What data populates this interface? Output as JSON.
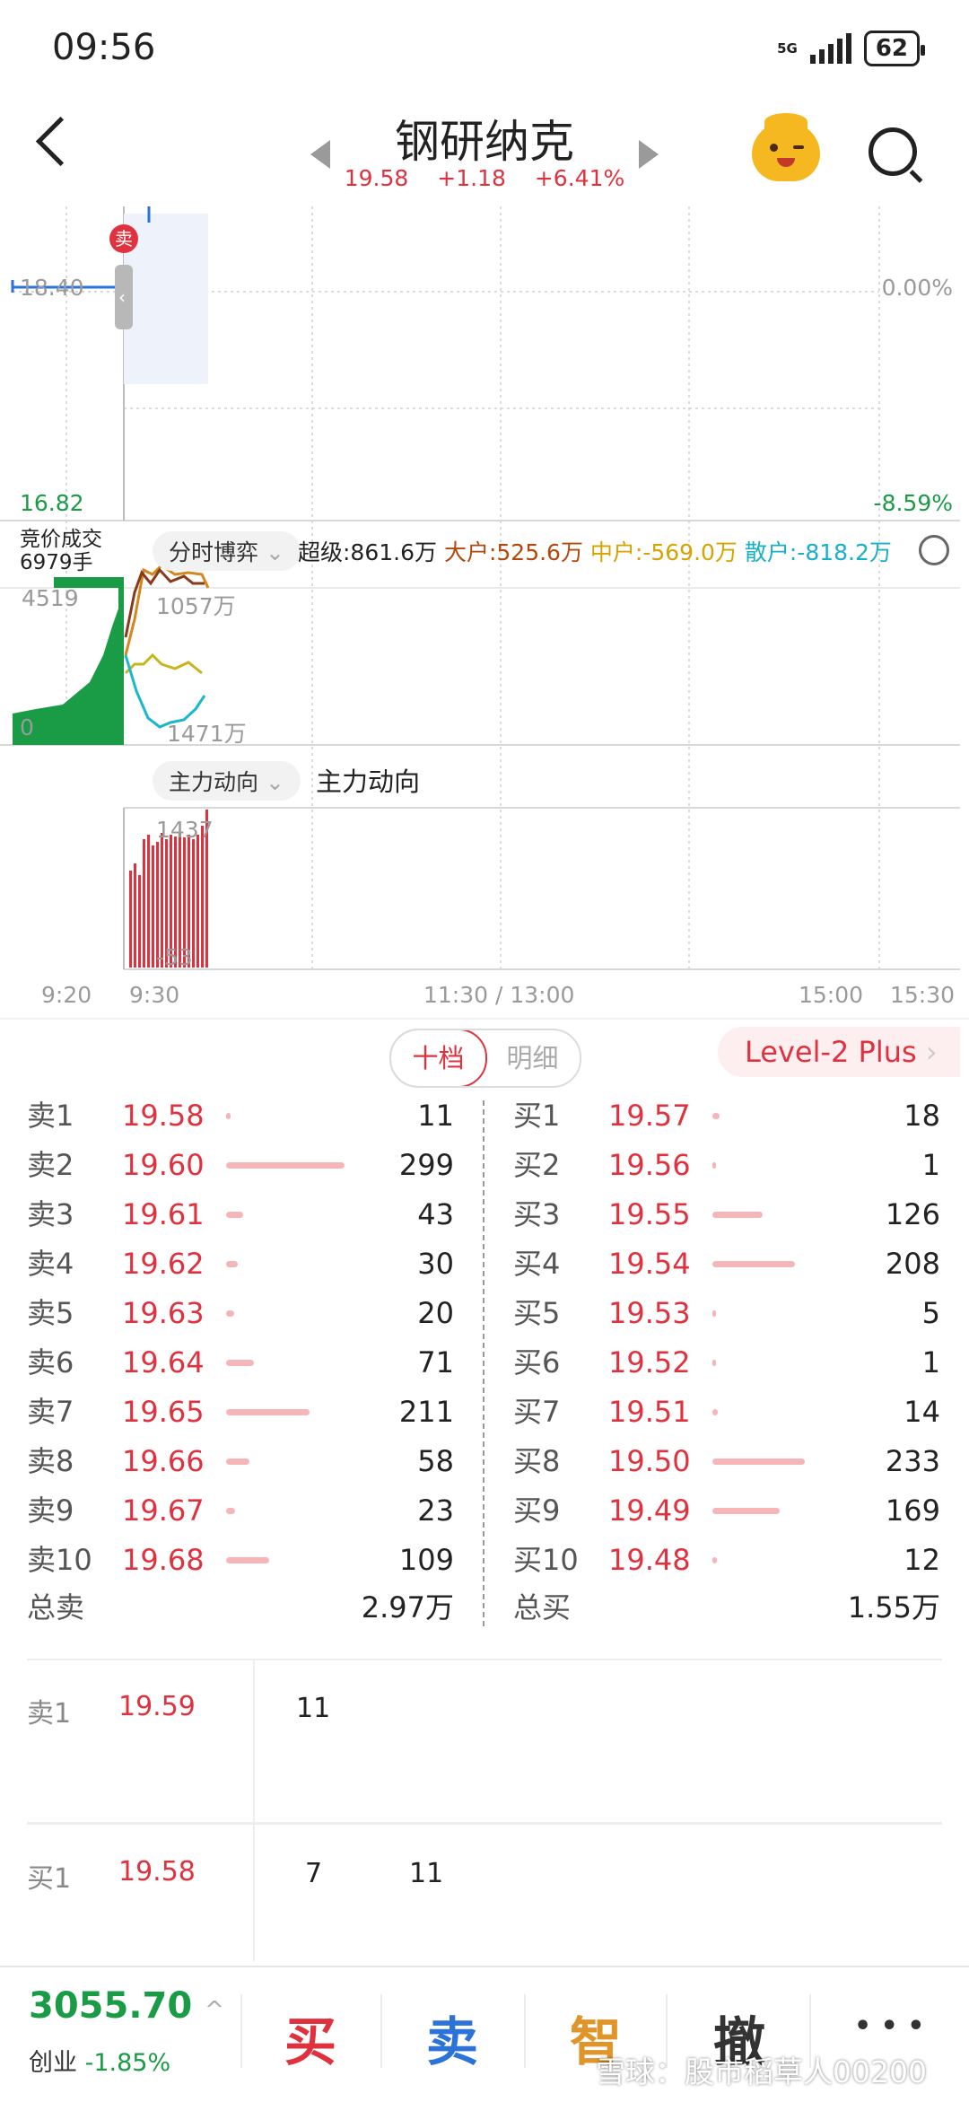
{
  "status_bar": {
    "time": "09:56",
    "network": "5G",
    "battery": "62"
  },
  "header": {
    "title": "钢研纳克",
    "price": "19.58",
    "change": "+1.18",
    "change_pct": "+6.41%"
  },
  "chart": {
    "price_ref": "18.40",
    "price_low": "16.82",
    "pct_ref": "0.00%",
    "pct_low": "-8.59%",
    "sell_marker": "卖",
    "auction_label": "竞价成交",
    "auction_volume": "6979手",
    "auction_top": "4519",
    "auction_zero": "0",
    "game_top": "1057万",
    "game_bottom": "1471万",
    "flow_top": "1437",
    "flow_bottom": "-53",
    "time_labels": [
      "9:20",
      "9:30",
      "11:30 / 13:00",
      "15:00",
      "15:30"
    ]
  },
  "toolbar1": {
    "mode": "分时博弈",
    "super": "超级:861.6万",
    "large": "大户:525.6万",
    "medium": "中户:-569.0万",
    "retail": "散户:-818.2万"
  },
  "toolbar2": {
    "mode": "主力动向",
    "label": "主力动向"
  },
  "orderbook": {
    "tabs": [
      "十档",
      "明细"
    ],
    "level2": "Level-2 Plus",
    "sell": [
      {
        "label": "卖1",
        "price": "19.58",
        "vol": "11"
      },
      {
        "label": "卖2",
        "price": "19.60",
        "vol": "299"
      },
      {
        "label": "卖3",
        "price": "19.61",
        "vol": "43"
      },
      {
        "label": "卖4",
        "price": "19.62",
        "vol": "30"
      },
      {
        "label": "卖5",
        "price": "19.63",
        "vol": "20"
      },
      {
        "label": "卖6",
        "price": "19.64",
        "vol": "71"
      },
      {
        "label": "卖7",
        "price": "19.65",
        "vol": "211"
      },
      {
        "label": "卖8",
        "price": "19.66",
        "vol": "58"
      },
      {
        "label": "卖9",
        "price": "19.67",
        "vol": "23"
      },
      {
        "label": "卖10",
        "price": "19.68",
        "vol": "109"
      }
    ],
    "buy": [
      {
        "label": "买1",
        "price": "19.57",
        "vol": "18"
      },
      {
        "label": "买2",
        "price": "19.56",
        "vol": "1"
      },
      {
        "label": "买3",
        "price": "19.55",
        "vol": "126"
      },
      {
        "label": "买4",
        "price": "19.54",
        "vol": "208"
      },
      {
        "label": "买5",
        "price": "19.53",
        "vol": "5"
      },
      {
        "label": "买6",
        "price": "19.52",
        "vol": "1"
      },
      {
        "label": "买7",
        "price": "19.51",
        "vol": "14"
      },
      {
        "label": "买8",
        "price": "19.50",
        "vol": "233"
      },
      {
        "label": "买9",
        "price": "19.49",
        "vol": "169"
      },
      {
        "label": "买10",
        "price": "19.48",
        "vol": "12"
      }
    ],
    "total_sell_label": "总卖",
    "total_sell": "2.97万",
    "total_buy_label": "总买",
    "total_buy": "1.55万"
  },
  "detail": {
    "sell1": {
      "label": "卖1",
      "price": "19.59",
      "vols": [
        "11"
      ]
    },
    "buy1": {
      "label": "买1",
      "price": "19.58",
      "vols": [
        "7",
        "11"
      ]
    }
  },
  "bottom": {
    "index_value": "3055.70",
    "index_name": "创业",
    "index_change": "-1.85%",
    "buy": "买",
    "sell": "卖",
    "smart": "智",
    "cancel": "撤",
    "more": "• • •",
    "watermark": "雪球：股市稻草人00200"
  },
  "colors": {
    "up": "#e0323e",
    "down": "#1a9b46",
    "accent_blue": "#2b73d8",
    "accent_orange": "#e0952a"
  }
}
